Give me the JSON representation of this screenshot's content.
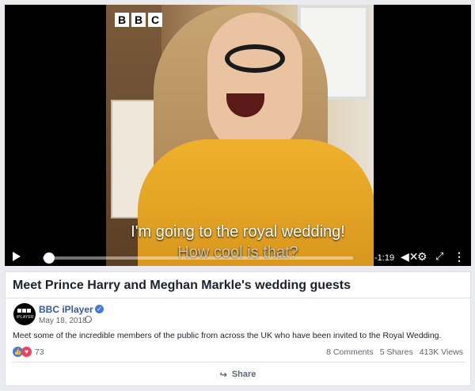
{
  "video": {
    "logo_letters": [
      "B",
      "B",
      "C"
    ],
    "subtitle_line1": "I'm going to the royal wedding!",
    "subtitle_line2": "How cool is that?",
    "time_remaining": "-1:19",
    "progress": 0.02
  },
  "post": {
    "title": "Meet Prince Harry and Meghan Markle's wedding guests",
    "page_name": "BBC iPlayer",
    "avatar_text": "iPLAYER",
    "date": "May 18, 2018 ·",
    "description": "Meet some of the incredible members of the public from across the UK who have been invited to the Royal Wedding.",
    "reactions_count": "73",
    "comments": "8 Comments",
    "shares": "5 Shares",
    "views": "413K Views",
    "share_label": "Share"
  },
  "colors": {
    "link_blue": "#385898",
    "accent_blue": "#4a78d8",
    "love_red": "#f0435a",
    "page_bg": "#e9ebee"
  }
}
